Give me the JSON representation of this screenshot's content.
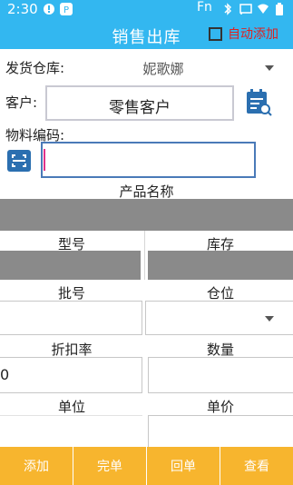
{
  "status": {
    "time": "2:30",
    "right": "Fn"
  },
  "header": {
    "title": "销售出库",
    "auto_add_label": "自动添加"
  },
  "form": {
    "warehouse_label": "发货仓库:",
    "warehouse_value": "妮歌娜",
    "customer_label": "客户:",
    "customer_value": "零售客户",
    "material_code_label": "物料编码:",
    "material_code_value": ""
  },
  "fields": {
    "product_name": "产品名称",
    "model": "型号",
    "stock": "库存",
    "batch": "批号",
    "location": "仓位",
    "discount_rate": "折扣率",
    "discount_value": "0",
    "quantity": "数量",
    "unit": "单位",
    "unit_price": "单价"
  },
  "bottom_bar": {
    "add": "添加",
    "finish": "完单",
    "back": "回单",
    "view": "查看"
  },
  "colors": {
    "header": "#33b7f0",
    "bottom_bar": "#f7b52e",
    "auto_label": "#dd2222",
    "icon_blue": "#2b6fb0"
  }
}
